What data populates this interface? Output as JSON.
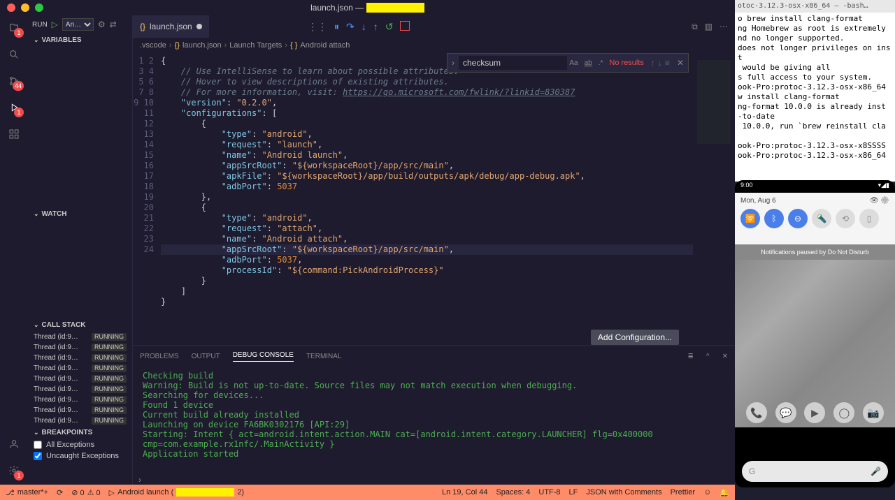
{
  "title": {
    "prefix": "launch.json — "
  },
  "sidebar_header": {
    "run": "RUN",
    "config": "An…"
  },
  "panels": {
    "variables": "VARIABLES",
    "watch": "WATCH",
    "callstack": "CALL STACK",
    "breakpoints": "BREAKPOINTS"
  },
  "callstack": [
    {
      "name": "Thread (id:9…",
      "state": "RUNNING"
    },
    {
      "name": "Thread (id:9…",
      "state": "RUNNING"
    },
    {
      "name": "Thread (id:9…",
      "state": "RUNNING"
    },
    {
      "name": "Thread (id:9…",
      "state": "RUNNING"
    },
    {
      "name": "Thread (id:9…",
      "state": "RUNNING"
    },
    {
      "name": "Thread (id:9…",
      "state": "RUNNING"
    },
    {
      "name": "Thread (id:9…",
      "state": "RUNNING"
    },
    {
      "name": "Thread (id:9…",
      "state": "RUNNING"
    },
    {
      "name": "Thread (id:9…",
      "state": "RUNNING"
    }
  ],
  "breakpoints": [
    {
      "label": "All Exceptions",
      "checked": false
    },
    {
      "label": "Uncaught Exceptions",
      "checked": true
    }
  ],
  "activity_badges": {
    "explorer": "1",
    "scm": "44",
    "debug": "1",
    "accounts": "1"
  },
  "tab": {
    "name": "launch.json"
  },
  "breadcrumb": {
    "root": ".vscode",
    "file": "launch.json",
    "section": "Launch Targets",
    "leaf": "Android attach"
  },
  "find": {
    "value": "checksum",
    "results": "No results"
  },
  "editor": {
    "lines": [
      1,
      2,
      3,
      4,
      5,
      6,
      7,
      8,
      9,
      10,
      11,
      12,
      13,
      14,
      15,
      16,
      17,
      18,
      19,
      20,
      21,
      22,
      23,
      24
    ],
    "comment1": "// Use IntelliSense to learn about possible attributes.",
    "comment2": "// Hover to view descriptions of existing attributes.",
    "comment3a": "// For more information, visit: ",
    "comment3b": "https://go.microsoft.com/fwlink/?linkid=830387",
    "version_key": "\"version\"",
    "version_val": "\"0.2.0\"",
    "config_key": "\"configurations\"",
    "type_key": "\"type\"",
    "android": "\"android\"",
    "request_key": "\"request\"",
    "launch": "\"launch\"",
    "attach": "\"attach\"",
    "name_key": "\"name\"",
    "android_launch": "\"Android launch\"",
    "android_attach": "\"Android attach\"",
    "appSrcRoot_key": "\"appSrcRoot\"",
    "appSrcRoot_val": "\"${workspaceRoot}/app/src/main\"",
    "apkFile_key": "\"apkFile\"",
    "apkFile_val": "\"${workspaceRoot}/app/build/outputs/apk/debug/app-debug.apk\"",
    "adbPort_key": "\"adbPort\"",
    "adbPort_val": "5037",
    "processId_key": "\"processId\"",
    "processId_val": "\"${command:PickAndroidProcess}\""
  },
  "add_config": "Add Configuration...",
  "panel_tabs": {
    "problems": "PROBLEMS",
    "output": "OUTPUT",
    "debug": "DEBUG CONSOLE",
    "terminal": "TERMINAL"
  },
  "console": "Checking build\nWarning: Build is not up-to-date. Source files may not match execution when debugging.\nSearching for devices...\nFound 1 device\nCurrent build already installed\nLaunching on device FA6BK0302176 [API:29]\nStarting: Intent { act=android.intent.action.MAIN cat=[android.intent.category.LAUNCHER] flg=0x400000 cmp=com.example.rx1nfc/.MainActivity }\nApplication started",
  "status": {
    "branch": "master*+",
    "sync": "⟳",
    "errors": "⊘ 0",
    "warnings": "⚠ 0",
    "launch": "Android launch (",
    "launch_suffix": "2)",
    "cursor": "Ln 19, Col 44",
    "spaces": "Spaces: 4",
    "encoding": "UTF-8",
    "eol": "LF",
    "lang": "JSON with Comments",
    "prettier": "Prettier"
  },
  "terminal": {
    "title": "otoc-3.12.3-osx-x86_64 — -bash…",
    "body": "o brew install clang-format\nng Homebrew as root is extremely\nnd no longer supported.\ndoes not longer privileges on inst\n would be giving all\ns full access to your system.\nook-Pro:protoc-3.12.3-osx-x86_64\nw install clang-format\nng-format 10.0.0 is already inst\n-to-date\n 10.0.0, run `brew reinstall cla\n\nook-Pro:protoc-3.12.3-osx-x8SSSS\nook-Pro:protoc-3.12.3-osx-x86_64"
  },
  "emulator": {
    "time": "9:00",
    "date": "Mon, Aug 6",
    "dnd": "Notifications paused by Do Not Disturb",
    "search_placeholder": "G"
  }
}
